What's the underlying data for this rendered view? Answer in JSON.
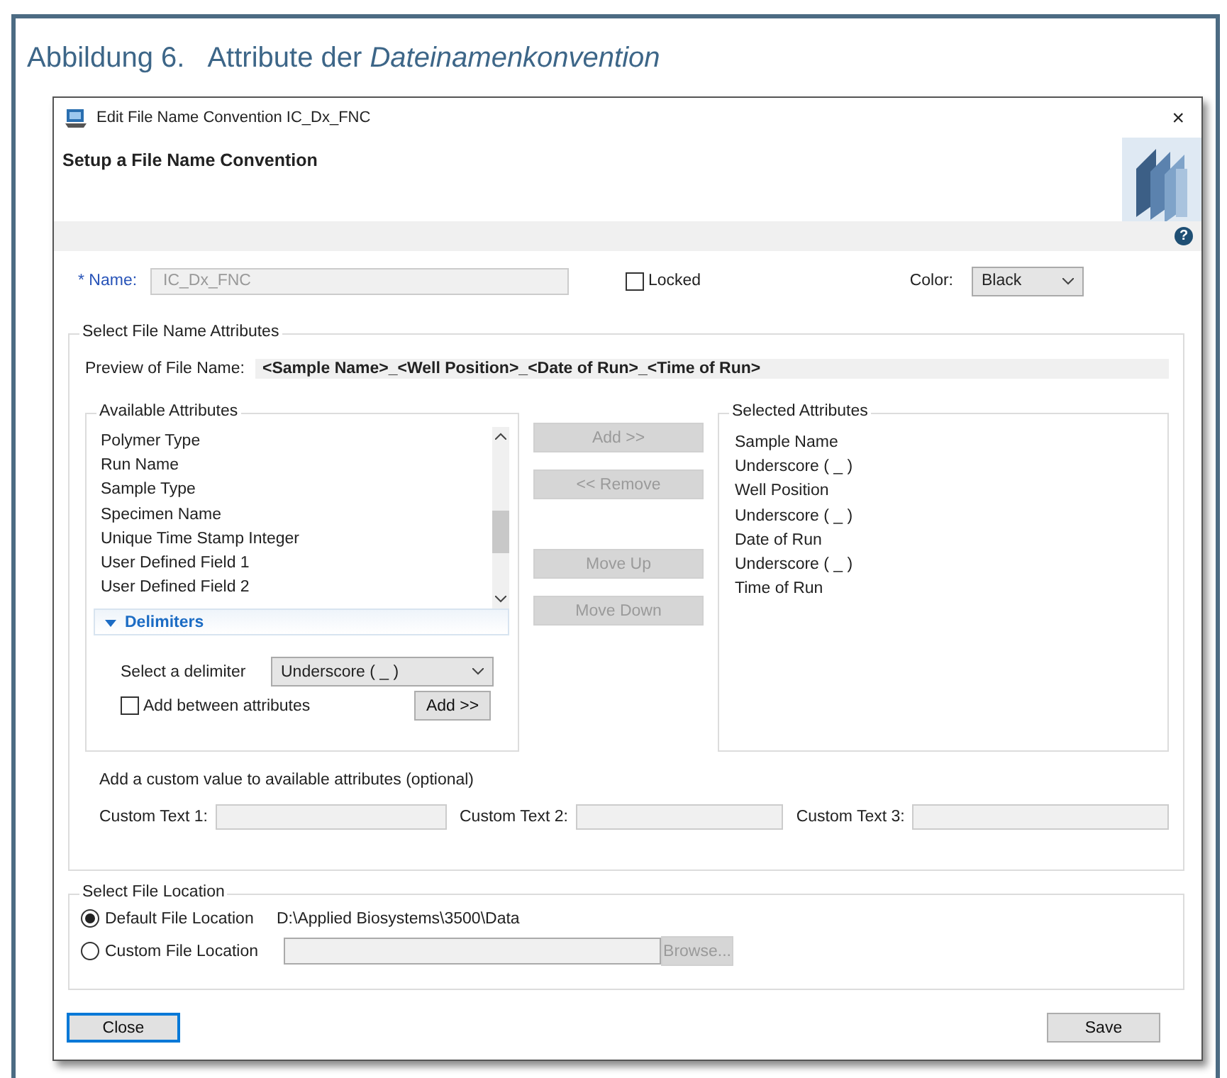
{
  "caption": {
    "label": "Abbildung 6.",
    "title": "Attribute der *Dateinamenkonvention*"
  },
  "window": {
    "title": "Edit File Name Convention IC_Dx_FNC",
    "close": "×"
  },
  "header": {
    "title": "Setup a File Name Convention",
    "help": "?"
  },
  "name_field": {
    "label": "* Name:",
    "value": "IC_Dx_FNC"
  },
  "locked": {
    "label": "Locked",
    "checked": false
  },
  "color": {
    "label": "Color:",
    "value": "Black"
  },
  "attributes": {
    "title": "Select File Name Attributes",
    "preview_label": "Preview of File Name:",
    "preview_value": "<Sample Name>_<Well Position>_<Date of Run>_<Time of Run>"
  },
  "available": {
    "title": "Available Attributes",
    "items": [
      "Polymer Type",
      "Run Name",
      "Sample Type",
      "Specimen Name",
      "Unique Time Stamp Integer",
      "User Defined Field 1",
      "User Defined Field 2"
    ]
  },
  "delimiters": {
    "title": "Delimiters",
    "expanded": true,
    "select_label": "Select a delimiter",
    "select_value": "Underscore ( _ )",
    "add_between": {
      "label": "Add between attributes",
      "checked": false
    },
    "add_button": "Add >>"
  },
  "move_buttons": [
    {
      "label": "Add >>",
      "disabled": true
    },
    {
      "label": "<< Remove",
      "disabled": true
    },
    {
      "label": "Move Up",
      "disabled": true
    },
    {
      "label": "Move Down",
      "disabled": true
    }
  ],
  "selected": {
    "title": "Selected Attributes",
    "items": [
      "Sample Name",
      "Underscore ( _ )",
      "Well Position",
      "Underscore ( _ )",
      "Date of Run",
      "Underscore ( _ )",
      "Time of Run"
    ]
  },
  "custom": {
    "prompt": "Add a custom value to available attributes (optional)",
    "fields": [
      {
        "label": "Custom Text 1:"
      },
      {
        "label": "Custom Text 2:"
      },
      {
        "label": "Custom Text 3:"
      }
    ]
  },
  "file_location": {
    "title": "Select File Location",
    "options": [
      {
        "label": "Default File Location",
        "selected": true,
        "kind": "path",
        "path": "D:\\Applied Biosystems\\3500\\Data"
      },
      {
        "label": "Custom File Location",
        "selected": false,
        "kind": "field"
      }
    ],
    "browse": {
      "label": "Browse...",
      "disabled": true
    }
  },
  "footer_buttons": [
    {
      "label": "Close",
      "focused": true
    },
    {
      "label": "Save",
      "focused": false
    }
  ]
}
